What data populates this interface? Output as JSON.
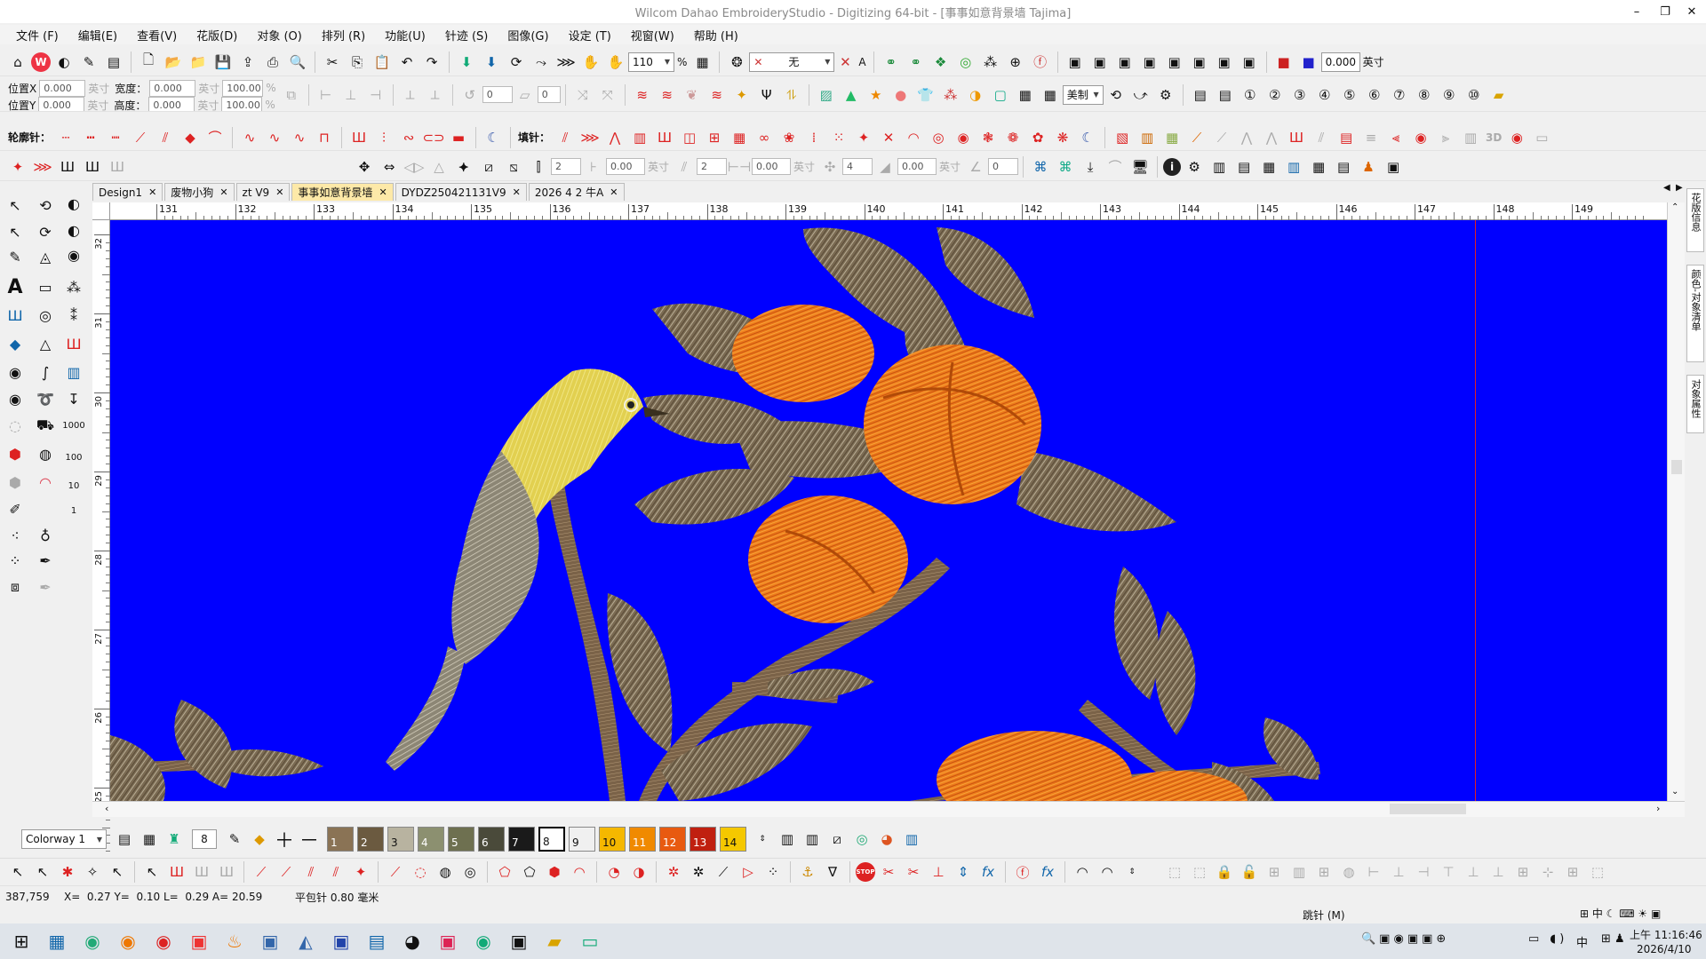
{
  "window": {
    "title": "Wilcom Dahao EmbroideryStudio - Digitizing 64-bit - [事事如意背景墙    Tajima]",
    "minimize": "–",
    "maximize": "❐",
    "close": "✕"
  },
  "menu": [
    "文件 (F)",
    "编辑(E)",
    "查看(V)",
    "花版(D)",
    "对象 (O)",
    "排列 (R)",
    "功能(U)",
    "针迹 (S)",
    "图像(G)",
    "设定 (T)",
    "视窗(W)",
    "帮助 (H)"
  ],
  "toolbar1": {
    "zoom_value": "110",
    "zoom_unit": "%",
    "stitch_type_value": "无",
    "width_value": "0.000",
    "width_unit": "英寸"
  },
  "position_panel": {
    "pos_x_label": "位置X",
    "pos_y_label": "位置Y",
    "pos_x": "0.000",
    "pos_y": "0.000",
    "unit": "英寸",
    "width_label": "宽度：",
    "height_label": "高度：",
    "width": "0.000",
    "height": "0.000",
    "size_unit": "英寸",
    "scale_w": "100.00",
    "scale_h": "100.00",
    "pct": "%",
    "rotate_value": "0",
    "skew_value": "0",
    "font_combo": "美制"
  },
  "toolbar3": {
    "outline_label": "轮廓针：",
    "fill_label": "填针："
  },
  "toolbar4": {
    "v1": "2",
    "v2": "0.00",
    "unit": "英寸",
    "v3": "2",
    "v4": "0.00",
    "v5": "4",
    "v6": "0.00",
    "v7": "0"
  },
  "tabs": [
    {
      "label": "Design1",
      "active": false
    },
    {
      "label": "废物小狗",
      "active": false
    },
    {
      "label": "zt V9",
      "active": false
    },
    {
      "label": "事事如意背景墙",
      "active": true
    },
    {
      "label": "DYDZ250421131V9",
      "active": false
    },
    {
      "label": "2026 4 2 牛A",
      "active": false
    }
  ],
  "ruler_top": [
    "131",
    "132",
    "133",
    "134",
    "135",
    "136",
    "137",
    "138",
    "139",
    "140",
    "141",
    "142",
    "143",
    "144",
    "145",
    "146",
    "147",
    "148",
    "149"
  ],
  "ruler_left": [
    "32",
    "31",
    "30",
    "29",
    "28",
    "27",
    "26",
    "25"
  ],
  "left_tools_text": {
    "num1000": "1000",
    "num100": "100",
    "num10": "10",
    "num1": "1"
  },
  "right_dock": [
    "花版信息",
    "颜色-对象清单",
    "对象属性"
  ],
  "colorbar": {
    "colorway": "Colorway 1",
    "current": "8",
    "swatches": [
      {
        "n": "1",
        "color": "#8a7355"
      },
      {
        "n": "2",
        "color": "#6b5a40"
      },
      {
        "n": "3",
        "color": "#b8b3a0"
      },
      {
        "n": "4",
        "color": "#8c9070"
      },
      {
        "n": "5",
        "color": "#6e7050"
      },
      {
        "n": "6",
        "color": "#4a4a3a"
      },
      {
        "n": "7",
        "color": "#1a1a1a"
      },
      {
        "n": "8",
        "color": "#ffffff"
      },
      {
        "n": "9",
        "color": "#f0f0f0"
      },
      {
        "n": "10",
        "color": "#f5b800"
      },
      {
        "n": "11",
        "color": "#f08a00"
      },
      {
        "n": "12",
        "color": "#e85a10"
      },
      {
        "n": "13",
        "color": "#c02010"
      },
      {
        "n": "14",
        "color": "#f5c800"
      }
    ]
  },
  "status": {
    "coords": "387,759",
    "x": "X=  0.27 Y=  0.10 L=  0.29 A= 20.59",
    "stitch": "平包针  0.80 毫米",
    "mode": "跳针 (M)"
  },
  "taskbar": {
    "time": "上午 11:16:46",
    "date": "2026/4/10",
    "ime": "中"
  },
  "colors": {
    "canvas": "#0000ff",
    "active_tab": "#fde9a8"
  }
}
